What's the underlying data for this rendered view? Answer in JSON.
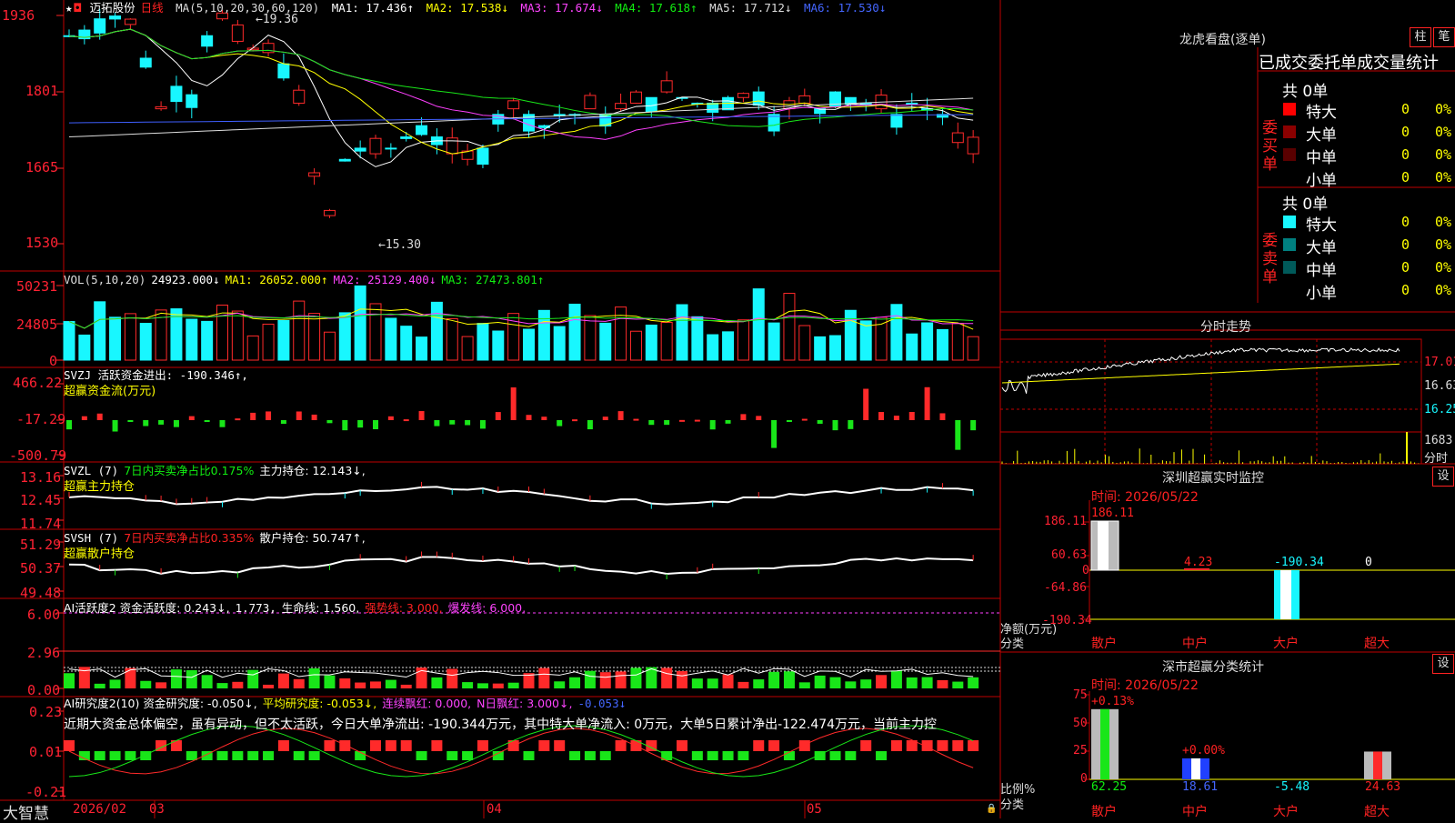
{
  "colors": {
    "up": "#ff2a2a",
    "down": "#18f7ff",
    "green": "#19e619",
    "grid": "#c00000",
    "white": "#ffffff",
    "yellow": "#ffff00",
    "magenta": "#ff40ff",
    "blue": "#3f5fff"
  },
  "kline": {
    "star": "★",
    "stock": "迈拓股份",
    "period": "日线",
    "ma_title": "MA(5,10,20,30,60,120)",
    "ma": [
      {
        "label": "MA1: 17.436↑",
        "color": "#ffffff"
      },
      {
        "label": "MA2: 17.538↓",
        "color": "#ffff00"
      },
      {
        "label": "MA3: 17.674↓",
        "color": "#ff40ff"
      },
      {
        "label": "MA4: 17.618↑",
        "color": "#19e619"
      },
      {
        "label": "MA5: 17.712↓",
        "color": "#dddddd"
      },
      {
        "label": "MA6: 17.530↓",
        "color": "#3f5fff"
      }
    ],
    "axis": [
      "1936",
      "1801",
      "1665",
      "1530"
    ],
    "high_label": "←19.36",
    "low_label": "←15.30"
  },
  "vol": {
    "title": "VOL(5,10,20)",
    "value": "24923.000↓",
    "ma1": "MA1: 26052.000↑",
    "ma2": "MA2: 25129.400↓",
    "ma3": "MA3: 27473.801↑",
    "axis": [
      "50231",
      "24805",
      "0"
    ]
  },
  "svzj": {
    "title": "SVZJ  活跃资金进出: -190.346↑,",
    "sub": "超赢资金流(万元)",
    "axis": [
      "466.22",
      "-17.29",
      "-500.79"
    ]
  },
  "svzl": {
    "title": "SVZL (7)",
    "t1": "7日内买卖净占比0.175%",
    "t2": "主力持仓: 12.143↓,",
    "sub": "超赢主力持仓",
    "axis": [
      "13.16",
      "12.45",
      "11.74"
    ]
  },
  "svsh": {
    "title": "SVSH (7)",
    "t1": "7日内买卖净占比0.335%",
    "t2": "散户持仓: 50.747↑,",
    "sub": "超赢散户持仓",
    "axis": [
      "51.29",
      "50.37",
      "49.48"
    ]
  },
  "ai1": {
    "t1": "AI活跃度2 资金活跃度: 0.243↓,",
    "t2": "1.773,",
    "t3": "生命线: 1.560,",
    "t4": "强势线: 3.000,",
    "t5": "爆发线: 6.000,",
    "axis": [
      "6.00",
      "2.96",
      "0.00"
    ]
  },
  "ai2": {
    "t1": "AI研究度2(10) 资金研究度: -0.050↓,",
    "t2": "平均研究度: -0.053↓,",
    "t3": "连续飘红: 0.000,",
    "t4": "N日飘红: 3.000↓,",
    "t5": "-0.053↓",
    "comment": "近期大资金总体偏空，虽有异动，但不太活跃，今日大单净流出: -190.344万元，其中特大单净流入: 0万元，大单5日累计净出-122.474万元，当前主力控",
    "axis": [
      "0.23",
      "0.01",
      "-0.21"
    ]
  },
  "bottom": {
    "brand": "大智慧",
    "dates": [
      "2026/02",
      "03",
      "04",
      "05"
    ]
  },
  "lhb": {
    "title": "龙虎看盘(逐单)",
    "btn1": "柱",
    "btn2": "笔",
    "tabs": [
      "已成交",
      "委托单",
      "成交量统计"
    ],
    "buy": {
      "side": "委买单",
      "total": "共 0单",
      "rows": [
        {
          "name": "特大",
          "v": "0",
          "p": "0%",
          "c": "#ff0000"
        },
        {
          "name": "大单",
          "v": "0",
          "p": "0%",
          "c": "#8b0000"
        },
        {
          "name": "中单",
          "v": "0",
          "p": "0%",
          "c": "#5a0000"
        },
        {
          "name": "小单",
          "v": "0",
          "p": "0%",
          "c": "#000000"
        }
      ]
    },
    "sell": {
      "side": "委卖单",
      "total": "共 0单",
      "rows": [
        {
          "name": "特大",
          "v": "0",
          "p": "0%",
          "c": "#18f7ff"
        },
        {
          "name": "大单",
          "v": "0",
          "p": "0%",
          "c": "#008080"
        },
        {
          "name": "中单",
          "v": "0",
          "p": "0%",
          "c": "#005a5a"
        },
        {
          "name": "小单",
          "v": "0",
          "p": "0%",
          "c": "#000000"
        }
      ]
    }
  },
  "fs": {
    "title": "分时走势",
    "axis": [
      "17.01",
      "16.63",
      "16.25"
    ],
    "vol": "1683",
    "unit": "分时"
  },
  "sz": {
    "title": "深圳超赢实时监控",
    "btn": "设",
    "time": "时间: 2026/05/22",
    "axis": [
      "186.11",
      "60.63",
      "0",
      "-64.86",
      "-190.34"
    ],
    "vals": [
      "186.11",
      "4.23",
      "-190.34",
      "0"
    ],
    "ylabel1": "净额(万元)",
    "ylabel2": "分类",
    "cats": [
      "散户",
      "中户",
      "大户",
      "超大"
    ]
  },
  "sc": {
    "title": "深市超赢分类统计",
    "btn": "设",
    "time": "时间: 2026/05/22",
    "axis": [
      "75",
      "50",
      "25",
      "0"
    ],
    "tops": [
      "+0.13%",
      "+0.00%"
    ],
    "vals": [
      "62.25",
      "18.61",
      "-5.48",
      "24.63"
    ],
    "ylabel1": "比例%",
    "ylabel2": "分类",
    "cats": [
      "散户",
      "中户",
      "大户",
      "超大"
    ]
  }
}
